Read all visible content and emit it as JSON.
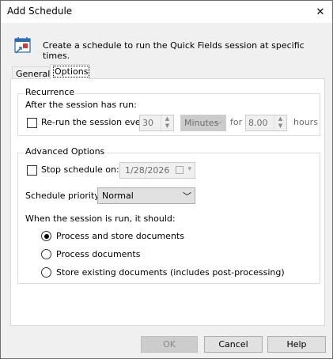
{
  "window": {
    "title": "Add Schedule",
    "close_glyph": "✕"
  },
  "header": {
    "icon": "calendar-schedule-icon",
    "text": "Create a schedule to run the Quick Fields session at specific times."
  },
  "tabs": [
    {
      "label": "General",
      "active": false
    },
    {
      "label": "Options",
      "active": true
    }
  ],
  "recurrence": {
    "legend": "Recurrence",
    "after_label": "After the session has run:",
    "rerun_label": "Re-run the session every:",
    "rerun_checked": false,
    "interval_value": "30",
    "unit_value": "Minutes",
    "for_label": "for",
    "hours_value": "8.00",
    "hours_label": "hours"
  },
  "advanced": {
    "legend": "Advanced Options",
    "stop_label": "Stop schedule on:",
    "stop_checked": false,
    "stop_date": "1/28/2026",
    "priority_label": "Schedule priority:",
    "priority_value": "Normal",
    "when_label": "When the session is run, it should:",
    "options": [
      {
        "label": "Process and store documents",
        "selected": true
      },
      {
        "label": "Process documents",
        "selected": false
      },
      {
        "label": "Store existing documents (includes post-processing)",
        "selected": false
      }
    ]
  },
  "buttons": {
    "ok": "OK",
    "cancel": "Cancel",
    "help": "Help"
  },
  "colors": {
    "accent_blue": "#2b6cb0",
    "accent_red": "#d0393e"
  }
}
